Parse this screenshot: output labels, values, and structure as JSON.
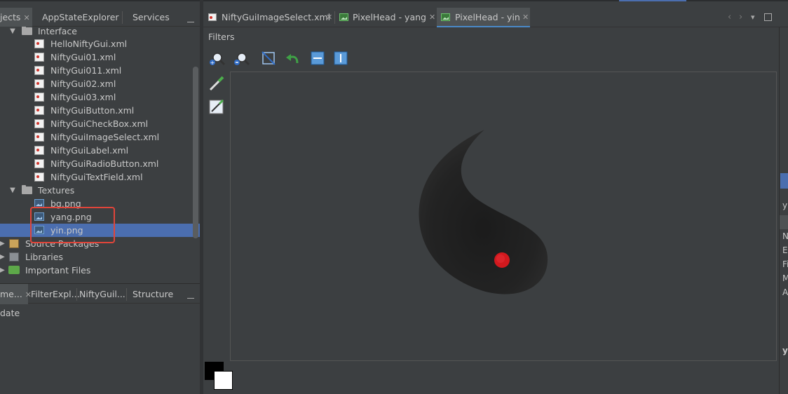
{
  "left_tabs": {
    "projects": "jects",
    "appstate": "AppStateExplorer",
    "services": "Services"
  },
  "tree": {
    "interface_folder": "Interface",
    "interface_files": [
      "HelloNiftyGui.xml",
      "NiftyGui01.xml",
      "NiftyGui011.xml",
      "NiftyGui02.xml",
      "NiftyGui03.xml",
      "NiftyGuiButton.xml",
      "NiftyGuiCheckBox.xml",
      "NiftyGuiImageSelect.xml",
      "NiftyGuiLabel.xml",
      "NiftyGuiRadioButton.xml",
      "NiftyGuiTextField.xml"
    ],
    "textures_folder": "Textures",
    "texture_files": [
      "bg.png",
      "yang.png",
      "yin.png"
    ],
    "source_packages": "Source Packages",
    "libraries": "Libraries",
    "important_files": "Important Files"
  },
  "bottom_left_tabs": {
    "navigator": "me...",
    "filter_explorer": "FilterExpl...",
    "nifty_gui": "NiftyGuil...",
    "structure": "Structure"
  },
  "bottom_left_content": "date",
  "editor_tabs": [
    {
      "label": "NiftyGuiImageSelect.xml"
    },
    {
      "label": "PixelHead - yang"
    },
    {
      "label": "PixelHead - yin"
    }
  ],
  "editor": {
    "filters_label": "Filters"
  },
  "right_panel_fragments": [
    "y",
    "N",
    "E:",
    "Fi",
    "M",
    "A",
    "yi"
  ],
  "colors": {
    "accent": "#4b6eaf",
    "highlight_box": "#e0453a",
    "yin_dot": "#d2191e"
  }
}
